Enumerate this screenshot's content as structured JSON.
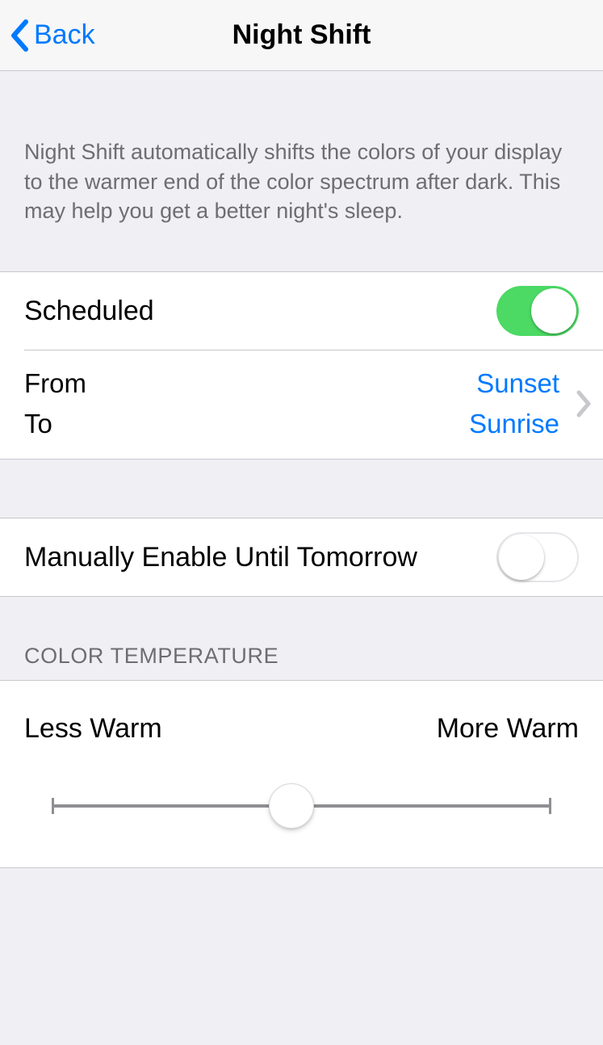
{
  "nav": {
    "back_label": "Back",
    "title": "Night Shift"
  },
  "description": "Night Shift automatically shifts the colors of your display to the warmer end of the color spectrum after dark. This may help you get a better night's sleep.",
  "scheduled": {
    "label": "Scheduled",
    "enabled": true,
    "from_label": "From",
    "to_label": "To",
    "from_value": "Sunset",
    "to_value": "Sunrise"
  },
  "manual": {
    "label": "Manually Enable Until Tomorrow",
    "enabled": false
  },
  "temperature": {
    "section_title": "COLOR TEMPERATURE",
    "min_label": "Less Warm",
    "max_label": "More Warm",
    "value_percent": 48
  },
  "colors": {
    "tint": "#007aff",
    "toggle_on": "#4cd964"
  }
}
